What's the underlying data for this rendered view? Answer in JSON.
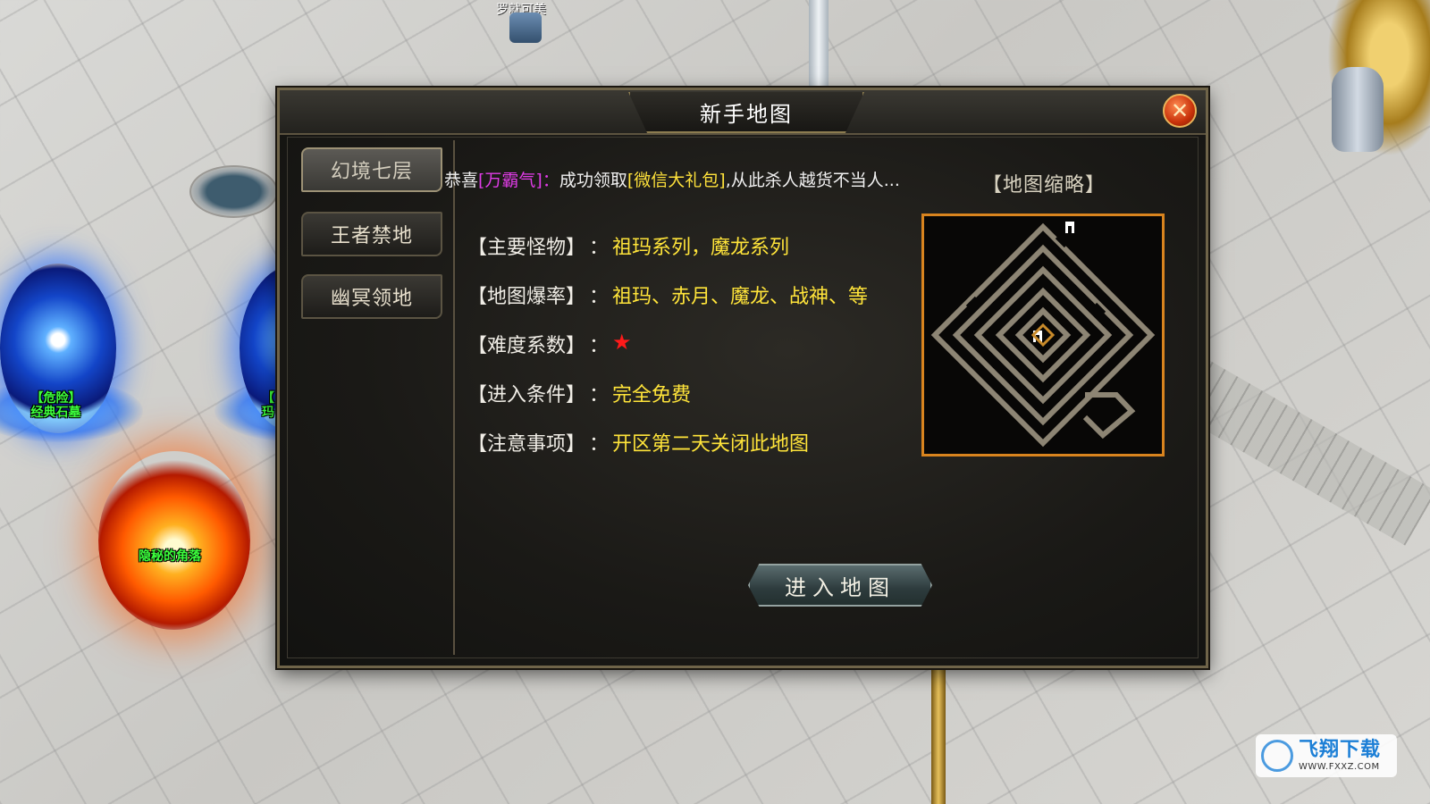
{
  "world": {
    "player_name": "罗就可美",
    "portal_left_label": [
      "【危险】",
      "经典石墓"
    ],
    "portal_right_label": [
      "【",
      "玛"
    ],
    "fire_label": "隐秘的角落"
  },
  "dialog": {
    "title": "新手地图",
    "close_icon": "close-icon"
  },
  "sidebar": {
    "items": [
      {
        "label": "幻境七层",
        "active": true
      },
      {
        "label": "王者禁地",
        "active": false
      },
      {
        "label": "幽冥领地",
        "active": false
      }
    ]
  },
  "marquee": {
    "prefix": "恭喜",
    "player": "[万霸气]",
    "colon": "：",
    "middle": "成功领取",
    "item": "[微信大礼包]",
    "suffix": ",从此杀人越货不当人..."
  },
  "map_thumb_label": "【地图缩略】",
  "info": [
    {
      "label": "【主要怪物】",
      "sep": "：",
      "value": "祖玛系列，魔龙系列"
    },
    {
      "label": "【地图爆率】",
      "sep": "：",
      "value": "祖玛、赤月、魔龙、战神、等"
    },
    {
      "label": "【难度系数】",
      "sep": "：",
      "value": "★"
    },
    {
      "label": "【进入条件】",
      "sep": "：",
      "value": "完全免费"
    },
    {
      "label": "【注意事项】",
      "sep": "：",
      "value": "开区第二天关闭此地图"
    }
  ],
  "enter_button": "进入地图",
  "watermark": {
    "name": "飞翔下载",
    "url": "WWW.FXXZ.COM"
  },
  "colors": {
    "accent_orange": "#d9841e",
    "value_yellow": "#ffe43a",
    "highlight_purple": "#e03ce7",
    "star_red": "#ff1a1a"
  }
}
